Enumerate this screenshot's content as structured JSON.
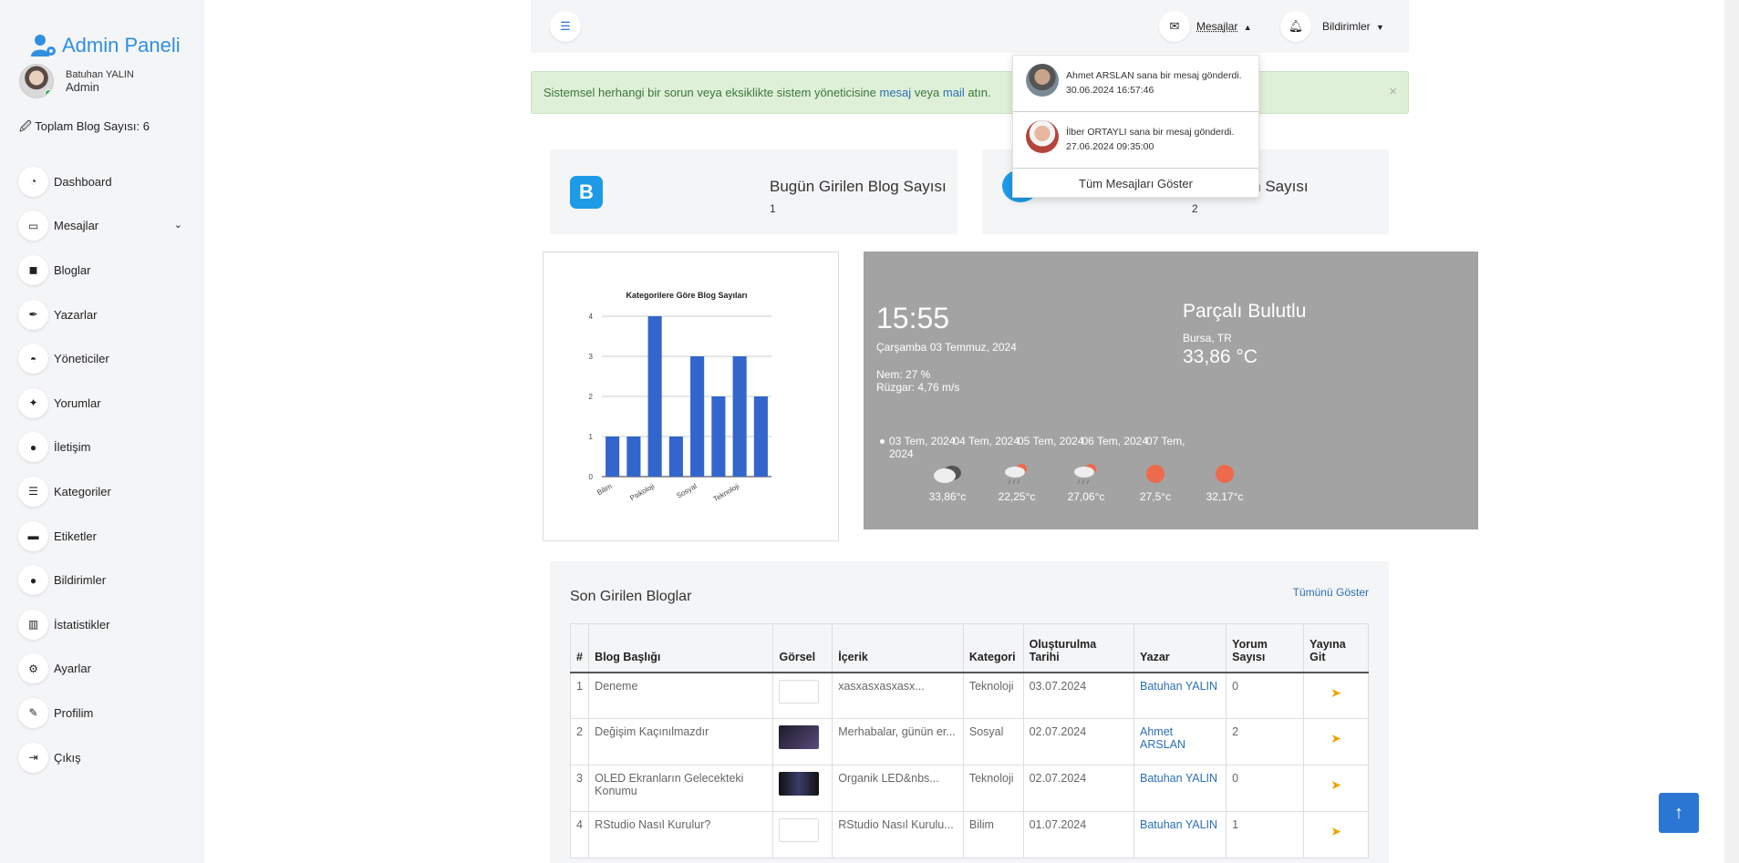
{
  "sidebar": {
    "brand": "Admin Paneli",
    "user_name": "Batuhan YALIN",
    "user_role": "Admin",
    "blog_count": "🖉 Toplam Blog Sayısı: 6",
    "items": [
      {
        "label": "Dashboard",
        "icon": "gauge-icon"
      },
      {
        "label": "Mesajlar",
        "icon": "laptop-icon"
      },
      {
        "label": "Bloglar",
        "icon": "blog-icon"
      },
      {
        "label": "Yazarlar",
        "icon": "pen-icon"
      },
      {
        "label": "Yöneticiler",
        "icon": "helmet-icon"
      },
      {
        "label": "Yorumlar",
        "icon": "comments-icon"
      },
      {
        "label": "İletişim",
        "icon": "chat-icon"
      },
      {
        "label": "Kategoriler",
        "icon": "list-icon"
      },
      {
        "label": "Etiketler",
        "icon": "tag-icon"
      },
      {
        "label": "Bildirimler",
        "icon": "info-icon"
      },
      {
        "label": "İstatistikler",
        "icon": "stats-icon"
      },
      {
        "label": "Ayarlar",
        "icon": "gears-icon"
      },
      {
        "label": "Profilim",
        "icon": "user-edit-icon"
      },
      {
        "label": "Çıkış",
        "icon": "logout-icon"
      }
    ]
  },
  "topbar": {
    "messages_label": "Mesajlar",
    "notifications_label": "Bildirimler"
  },
  "alert": {
    "text_before": "Sistemsel herhangi bir sorun veya eksiklikte sistem yöneticisine ",
    "link1": "mesaj",
    "text_mid": " veya ",
    "link2": "mail",
    "text_after": " atın.",
    "close": "×"
  },
  "dropdown": {
    "messages": [
      {
        "text": "Ahmet ARSLAN sana bir mesaj gönderdi.",
        "time": "30.06.2024 16:57:46"
      },
      {
        "text": "İlber ORTAYLI sana bir mesaj gönderdi.",
        "time": "27.06.2024 09:35:00"
      }
    ],
    "footer": "Tüm Mesajları Göster"
  },
  "cards": {
    "blogs_title": "Bugün Girilen Blog Sayısı",
    "blogs_value": "1",
    "comments_title": "len Yorum Sayısı",
    "comments_value": "2"
  },
  "chart_data": {
    "type": "bar",
    "title": "Kategorilere Göre Blog Sayıları",
    "categories": [
      "Bilim",
      "",
      "Psikoloji",
      "",
      "Sosyal",
      "",
      "Teknoloji",
      ""
    ],
    "values": [
      1,
      1,
      4,
      1,
      3,
      2,
      3,
      2
    ],
    "ylim": [
      0,
      4
    ],
    "yticks": [
      "0",
      "1",
      "2",
      "3",
      "4"
    ],
    "color": "#3366cc"
  },
  "weather": {
    "time": "15:55",
    "date": "Çarşamba 03 Temmuz, 2024",
    "humidity": "Nem: 27 %",
    "wind": "Rüzgar: 4,76 m/s",
    "condition": "Parçalı Bulutlu",
    "location": "Bursa, TR",
    "temperature": "33,86 °C",
    "forecast_dates": [
      "03 Tem, 2024",
      "04 Tem, 2024",
      "05 Tem, 2024",
      "06 Tem, 2024",
      "07 Tem, 2024"
    ],
    "forecast": [
      {
        "temp": "33,86°c",
        "icon": "cloud-icon"
      },
      {
        "temp": "22,25°c",
        "icon": "rain-sun-icon"
      },
      {
        "temp": "27,06°c",
        "icon": "rain-sun-icon"
      },
      {
        "temp": "27,5°c",
        "icon": "sun-icon"
      },
      {
        "temp": "32,17°c",
        "icon": "sun-icon"
      }
    ]
  },
  "recent": {
    "title": "Son Girilen Bloglar",
    "show_all": "Tümünü Göster",
    "headers": [
      "#",
      "Blog Başlığı",
      "Görsel",
      "İçerik",
      "Kategori",
      "Oluşturulma Tarihi",
      "Yazar",
      "Yorum Sayısı",
      "Yayına Git"
    ],
    "rows": [
      {
        "no": "1",
        "title": "Deneme",
        "content": "xasxasxasxasx...",
        "category": "Teknoloji",
        "date": "03.07.2024",
        "author": "Batuhan YALIN",
        "comments": "0"
      },
      {
        "no": "2",
        "title": "Değişim Kaçınılmazdır",
        "content": "Merhabalar, günün er...",
        "category": "Sosyal",
        "date": "02.07.2024",
        "author": "Ahmet ARSLAN",
        "comments": "2"
      },
      {
        "no": "3",
        "title": "OLED Ekranların Gelecekteki Konumu",
        "content": "Organik LED&nbs...",
        "category": "Teknoloji",
        "date": "02.07.2024",
        "author": "Batuhan YALIN",
        "comments": "0"
      },
      {
        "no": "4",
        "title": "RStudio Nasıl Kurulur?",
        "content": "RStudio Nasıl Kurulu...",
        "category": "Bilim",
        "date": "01.07.2024",
        "author": "Batuhan YALIN",
        "comments": "1"
      }
    ]
  }
}
